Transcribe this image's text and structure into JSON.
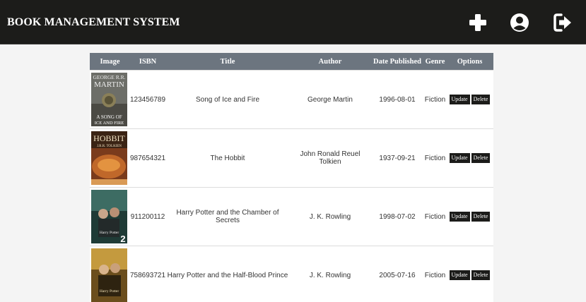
{
  "header": {
    "title": "BOOK MANAGEMENT SYSTEM",
    "icons": [
      "plus-icon",
      "user-icon",
      "logout-icon"
    ]
  },
  "table": {
    "columns": [
      "Image",
      "ISBN",
      "Title",
      "Author",
      "Date Published",
      "Genre",
      "Options"
    ],
    "rows": [
      {
        "cover": "song-of-ice-and-fire-cover",
        "cover_author": "GEORGE R.R.",
        "cover_author2": "MARTIN",
        "cover_title": "A SONG OF",
        "cover_title2": "ICE AND FIRE",
        "isbn": "123456789",
        "title": "Song of Ice and Fire",
        "author": "George Martin",
        "date": "1996-08-01",
        "genre": "Fiction",
        "update": "Update",
        "delete": "Delete"
      },
      {
        "cover": "hobbit-cover",
        "cover_title": "HOBBIT",
        "cover_author": "J.R.R. TOLKIEN",
        "isbn": "987654321",
        "title": "The Hobbit",
        "author": "John Ronald Reuel Tolkien",
        "date": "1937-09-21",
        "genre": "Fiction",
        "update": "Update",
        "delete": "Delete"
      },
      {
        "cover": "chamber-of-secrets-cover",
        "cover_title": "Harry Potter",
        "isbn": "911200112",
        "title": "Harry Potter and the Chamber of Secrets",
        "author": "J. K. Rowling",
        "date": "1998-07-02",
        "genre": "Fiction",
        "update": "Update",
        "delete": "Delete"
      },
      {
        "cover": "half-blood-prince-cover",
        "cover_title": "Harry Potter",
        "isbn": "758693721",
        "title": "Harry Potter and the Half-Blood Prince",
        "author": "J. K. Rowling",
        "date": "2005-07-16",
        "genre": "Fiction",
        "update": "Update",
        "delete": "Delete"
      }
    ]
  },
  "colors": {
    "header_bg": "#1c1c1a",
    "table_head_bg": "#6c757f",
    "button_bg": "#1c1c1a",
    "page_bg": "#f4f4f4"
  }
}
